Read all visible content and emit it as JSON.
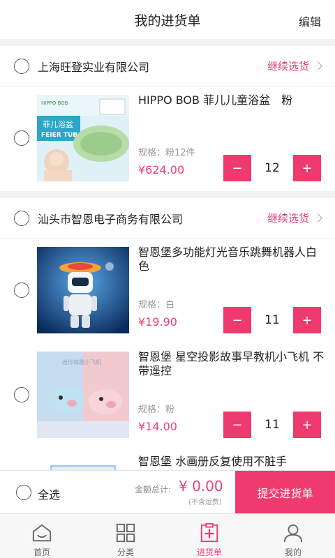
{
  "header": {
    "title": "我的进货单",
    "edit": "编辑"
  },
  "shops": [
    {
      "name": "上海旺登实业有限公司",
      "continue": "继续选货",
      "items": [
        {
          "name": "HIPPO BOB 菲儿儿童浴盆　粉",
          "spec": "规格：粉12件",
          "price": "¥624.00",
          "qty": "12",
          "thumb_text": "菲儿浴盆\nFEIER TUB",
          "thumb_brand": "HIPPO BOB"
        }
      ]
    },
    {
      "name": "汕头市智恩电子商务有限公司",
      "continue": "继续选货",
      "items": [
        {
          "name": "智恩堡多功能灯光音乐跳舞机器人白色",
          "spec": "规格：白",
          "price": "¥19.90",
          "qty": "11"
        },
        {
          "name": "智恩堡 星空投影故事早教机小飞机 不带遥控",
          "spec": "规格：粉",
          "price": "¥14.00",
          "qty": "11",
          "thumb_caption": "迷你萌趣小飞机"
        },
        {
          "name": "智恩堡 水画册反复使用不脏手"
        }
      ]
    }
  ],
  "stepper": {
    "minus": "−",
    "plus": "+"
  },
  "footer": {
    "select_all": "全选",
    "total_label": "金额总计:",
    "total_value": "¥ 0.00",
    "note": "(不含运费)",
    "submit": "提交进货单"
  },
  "tabs": [
    {
      "label": "首页",
      "icon": "home-icon"
    },
    {
      "label": "分类",
      "icon": "category-icon"
    },
    {
      "label": "进货单",
      "icon": "order-icon",
      "active": true
    },
    {
      "label": "我的",
      "icon": "user-icon"
    }
  ],
  "colors": {
    "accent": "#ef3a6e",
    "accent_text": "#e8407a"
  }
}
